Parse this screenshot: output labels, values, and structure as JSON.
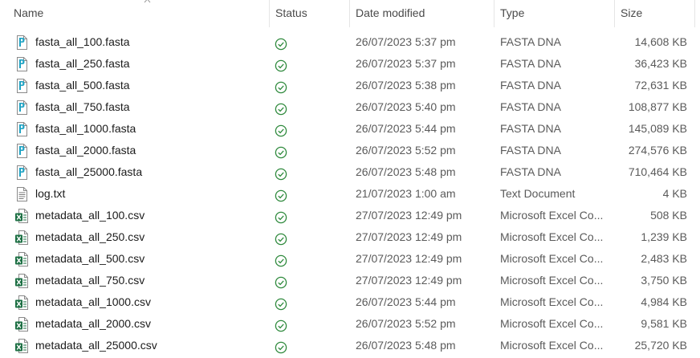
{
  "columns": {
    "name": "Name",
    "status": "Status",
    "date_modified": "Date modified",
    "type": "Type",
    "size": "Size"
  },
  "sort": {
    "column": "name",
    "direction": "ascending"
  },
  "colors": {
    "fasta_icon": "#1fa3c4",
    "excel_icon": "#1d7044",
    "status_ok": "#2f8a3d",
    "text_icon": "#7a7a7a"
  },
  "files": [
    {
      "name": "fasta_all_100.fasta",
      "icon": "fasta-file-icon",
      "status": "available-icon",
      "date": "26/07/2023 5:37 pm",
      "type": "FASTA DNA",
      "size": "14,608 KB"
    },
    {
      "name": "fasta_all_250.fasta",
      "icon": "fasta-file-icon",
      "status": "available-icon",
      "date": "26/07/2023 5:37 pm",
      "type": "FASTA DNA",
      "size": "36,423 KB"
    },
    {
      "name": "fasta_all_500.fasta",
      "icon": "fasta-file-icon",
      "status": "available-icon",
      "date": "26/07/2023 5:38 pm",
      "type": "FASTA DNA",
      "size": "72,631 KB"
    },
    {
      "name": "fasta_all_750.fasta",
      "icon": "fasta-file-icon",
      "status": "available-icon",
      "date": "26/07/2023 5:40 pm",
      "type": "FASTA DNA",
      "size": "108,877 KB"
    },
    {
      "name": "fasta_all_1000.fasta",
      "icon": "fasta-file-icon",
      "status": "available-icon",
      "date": "26/07/2023 5:44 pm",
      "type": "FASTA DNA",
      "size": "145,089 KB"
    },
    {
      "name": "fasta_all_2000.fasta",
      "icon": "fasta-file-icon",
      "status": "available-icon",
      "date": "26/07/2023 5:52 pm",
      "type": "FASTA DNA",
      "size": "274,576 KB"
    },
    {
      "name": "fasta_all_25000.fasta",
      "icon": "fasta-file-icon",
      "status": "available-icon",
      "date": "26/07/2023 5:48 pm",
      "type": "FASTA DNA",
      "size": "710,464 KB"
    },
    {
      "name": "log.txt",
      "icon": "text-file-icon",
      "status": "available-icon",
      "date": "21/07/2023 1:00 am",
      "type": "Text Document",
      "size": "4 KB"
    },
    {
      "name": "metadata_all_100.csv",
      "icon": "excel-file-icon",
      "status": "available-icon",
      "date": "27/07/2023 12:49 pm",
      "type": "Microsoft Excel Co...",
      "size": "508 KB"
    },
    {
      "name": "metadata_all_250.csv",
      "icon": "excel-file-icon",
      "status": "available-icon",
      "date": "27/07/2023 12:49 pm",
      "type": "Microsoft Excel Co...",
      "size": "1,239 KB"
    },
    {
      "name": "metadata_all_500.csv",
      "icon": "excel-file-icon",
      "status": "available-icon",
      "date": "27/07/2023 12:49 pm",
      "type": "Microsoft Excel Co...",
      "size": "2,483 KB"
    },
    {
      "name": "metadata_all_750.csv",
      "icon": "excel-file-icon",
      "status": "available-icon",
      "date": "27/07/2023 12:49 pm",
      "type": "Microsoft Excel Co...",
      "size": "3,750 KB"
    },
    {
      "name": "metadata_all_1000.csv",
      "icon": "excel-file-icon",
      "status": "available-icon",
      "date": "26/07/2023 5:44 pm",
      "type": "Microsoft Excel Co...",
      "size": "4,984 KB"
    },
    {
      "name": "metadata_all_2000.csv",
      "icon": "excel-file-icon",
      "status": "available-icon",
      "date": "26/07/2023 5:52 pm",
      "type": "Microsoft Excel Co...",
      "size": "9,581 KB"
    },
    {
      "name": "metadata_all_25000.csv",
      "icon": "excel-file-icon",
      "status": "available-icon",
      "date": "26/07/2023 5:48 pm",
      "type": "Microsoft Excel Co...",
      "size": "25,720 KB"
    }
  ]
}
